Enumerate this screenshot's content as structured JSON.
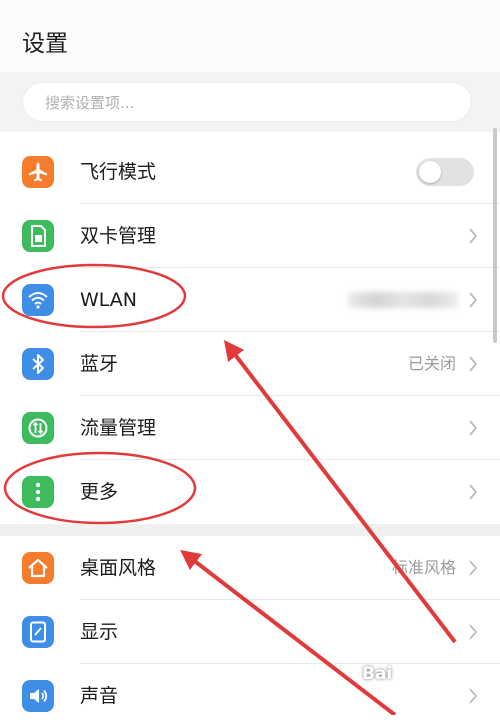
{
  "header": {
    "title": "设置"
  },
  "search": {
    "placeholder": "搜索设置项..."
  },
  "items": [
    {
      "label": "飞行模式",
      "icon": "airplane-icon",
      "color": "#f57c2b",
      "control": "toggle",
      "toggle_on": false
    },
    {
      "label": "双卡管理",
      "icon": "sim-card-icon",
      "color": "#3dbb5d",
      "control": "chevron"
    },
    {
      "label": "WLAN",
      "icon": "wifi-icon",
      "color": "#3e8ee8",
      "control": "chevron",
      "value_redacted": true
    },
    {
      "label": "蓝牙",
      "icon": "bluetooth-icon",
      "color": "#3e8ee8",
      "value": "已关闭",
      "control": "chevron"
    },
    {
      "label": "流量管理",
      "icon": "data-usage-icon",
      "color": "#3dbb5d",
      "control": "chevron"
    },
    {
      "label": "更多",
      "icon": "more-icon",
      "color": "#3dbb5d",
      "control": "chevron"
    },
    {
      "label": "桌面风格",
      "icon": "home-icon",
      "color": "#f57c2b",
      "value": "标准风格",
      "control": "chevron"
    },
    {
      "label": "显示",
      "icon": "display-icon",
      "color": "#3e8ee8",
      "control": "chevron"
    },
    {
      "label": "声音",
      "icon": "sound-icon",
      "color": "#3e8ee8",
      "control": "chevron"
    }
  ],
  "annotations": {
    "highlight_color": "#e03a3a"
  },
  "watermark": {
    "text": "Bai"
  }
}
